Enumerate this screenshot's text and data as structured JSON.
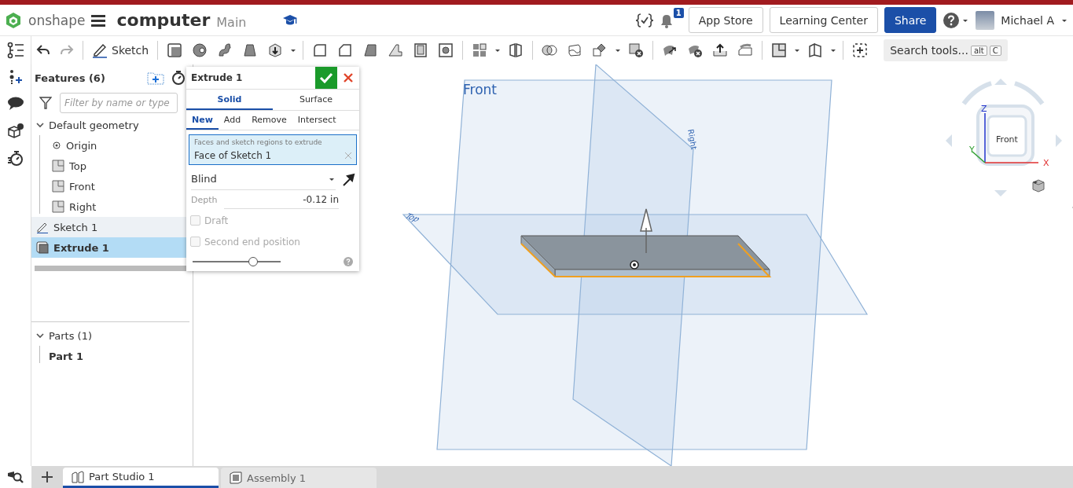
{
  "header": {
    "brand": "onshape",
    "document": "computer",
    "workspace": "Main",
    "notification_count": "1",
    "buttons": [
      "App Store",
      "Learning Center"
    ],
    "share": "Share",
    "user": "Michael A"
  },
  "toolbar": {
    "sketch": "Sketch",
    "search": "Search tools...",
    "shortcut_keys": [
      "alt",
      "C"
    ]
  },
  "features": {
    "title": "Features (6)",
    "filter_placeholder": "Filter by name or type",
    "tree": [
      {
        "label": "Default geometry",
        "kind": "group",
        "expanded": true,
        "selected": false,
        "children": [
          {
            "label": "Origin",
            "kind": "point",
            "selected": false
          },
          {
            "label": "Top",
            "kind": "plane",
            "selected": false
          },
          {
            "label": "Front",
            "kind": "plane",
            "selected": false
          },
          {
            "label": "Right",
            "kind": "plane",
            "selected": false
          }
        ]
      },
      {
        "label": "Sketch 1",
        "kind": "sketch",
        "selected": false
      },
      {
        "label": "Extrude 1",
        "kind": "extrude",
        "selected": true
      }
    ],
    "parts": {
      "title": "Parts (1)",
      "expanded": true,
      "items": [
        {
          "label": "Part 1"
        }
      ]
    }
  },
  "dialog": {
    "title": "Extrude 1",
    "types": [
      {
        "label": "Solid",
        "selected": true
      },
      {
        "label": "Surface",
        "selected": false
      }
    ],
    "operations": [
      {
        "label": "New",
        "selected": true
      },
      {
        "label": "Add",
        "selected": false
      },
      {
        "label": "Remove",
        "selected": false
      },
      {
        "label": "Intersect",
        "selected": false
      }
    ],
    "selection_field": {
      "label": "Faces and sketch regions to extrude",
      "value": "Face of Sketch 1"
    },
    "end_type": "Blind",
    "depth": {
      "label": "Depth",
      "value": "-0.12 in"
    },
    "options": [
      {
        "label": "Draft",
        "checked": false,
        "disabled": true
      },
      {
        "label": "Second end position",
        "checked": false,
        "disabled": true
      }
    ],
    "slider": {
      "level": 0.69
    }
  },
  "viewport": {
    "plane_labels": [
      {
        "label": "Front",
        "kind": "front"
      },
      {
        "label": "Top",
        "kind": "top"
      },
      {
        "label": "Right",
        "kind": "right"
      }
    ]
  },
  "view_cube": {
    "face": "Front",
    "axes": [
      "X",
      "Y",
      "Z"
    ]
  },
  "tabs": [
    {
      "label": "Part Studio 1",
      "kind": "part_studio",
      "selected": true
    },
    {
      "label": "Assembly 1",
      "kind": "assembly",
      "selected": false
    }
  ]
}
